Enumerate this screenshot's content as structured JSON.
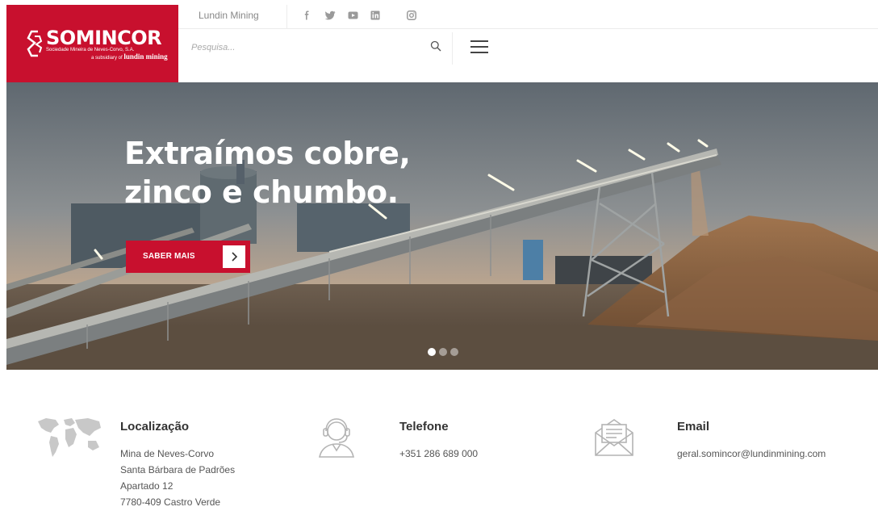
{
  "brand": {
    "name": "SOMINCOR",
    "subtitle": "Sociedade Mineira de Neves-Corvo, S.A.",
    "subsidiary_prefix": "a subsidiary of",
    "subsidiary_name": "lundin mining",
    "color": "#c8102e"
  },
  "topbar": {
    "parent_link": "Lundin Mining",
    "social_icons": [
      "facebook-icon",
      "twitter-icon",
      "youtube-icon",
      "linkedin-icon",
      "instagram-icon"
    ]
  },
  "search": {
    "placeholder": "Pesquisa..."
  },
  "hero": {
    "title_line1": "Extraímos cobre,",
    "title_line2": "zinco e chumbo.",
    "cta_label": "SABER MAIS",
    "slides_total": 3,
    "active_slide": 1
  },
  "contact": {
    "location": {
      "heading": "Localização",
      "lines": [
        "Mina de Neves-Corvo",
        "Santa Bárbara de Padrões",
        "Apartado 12",
        "7780-409 Castro Verde"
      ],
      "icon": "world-map-icon"
    },
    "phone": {
      "heading": "Telefone",
      "value": "+351 286 689 000",
      "icon": "headset-operator-icon"
    },
    "email": {
      "heading": "Email",
      "value": "geral.somincor@lundinmining.com",
      "icon": "envelope-icon"
    }
  }
}
